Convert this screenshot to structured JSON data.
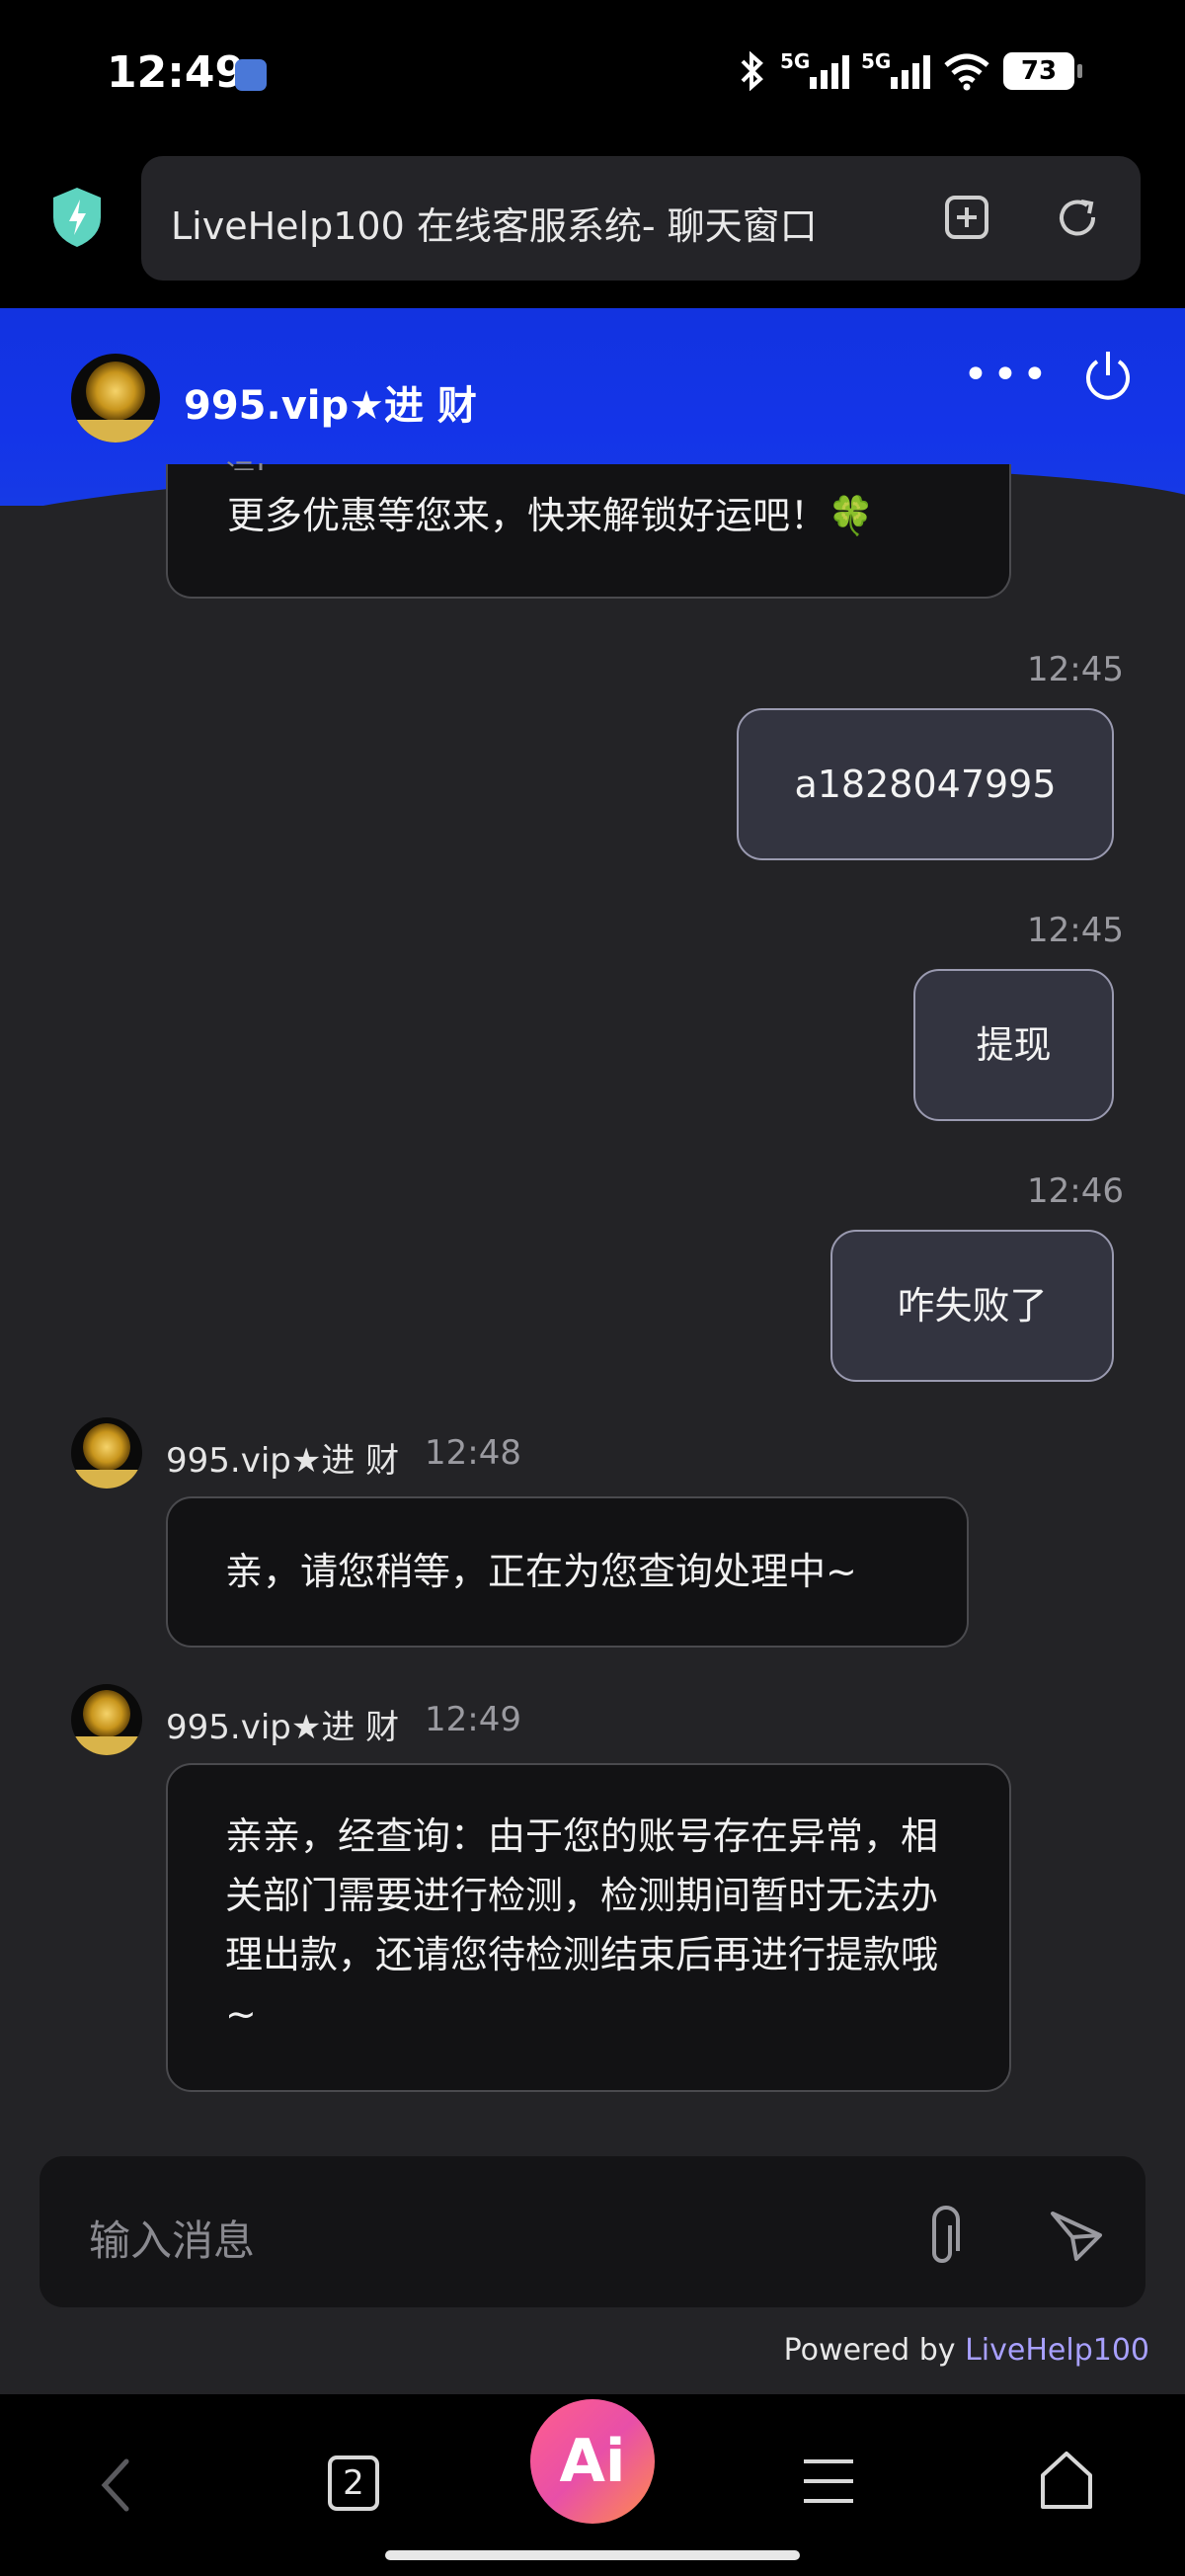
{
  "status_bar": {
    "time": "12:49",
    "network_1": "5G",
    "network_2": "5G",
    "battery": "73"
  },
  "browser": {
    "title": "LiveHelp100 在线客服系统- 聊天窗口"
  },
  "chat_header": {
    "agent_name": "995.vip★进 财"
  },
  "messages": {
    "m0": {
      "partial_top": "运!",
      "text": "更多优惠等您来，快来解锁好运吧！🍀"
    },
    "m1": {
      "time": "12:45",
      "text": "a1828047995"
    },
    "m2": {
      "time": "12:45",
      "text": "提现"
    },
    "m3": {
      "time": "12:46",
      "text": "咋失败了"
    },
    "m4": {
      "sender": "995.vip★进 财",
      "time": "12:48",
      "text": "亲，请您稍等，正在为您查询处理中~"
    },
    "m5": {
      "sender": "995.vip★进 财",
      "time": "12:49",
      "text": "亲亲，经查询：由于您的账号存在异常，相关部门需要进行检测，检测期间暂时无法办理出款，还请您待检测结束后再进行提款哦~"
    }
  },
  "input": {
    "placeholder": "输入消息"
  },
  "footer": {
    "powered_prefix": "Powered by ",
    "powered_link": "LiveHelp100"
  },
  "nav": {
    "tabs_count": "2",
    "ai_label": "Ai"
  },
  "colors": {
    "header_blue": "#1434e8",
    "link": "#a8a0ff",
    "ai_pink": "#e84fa8"
  }
}
